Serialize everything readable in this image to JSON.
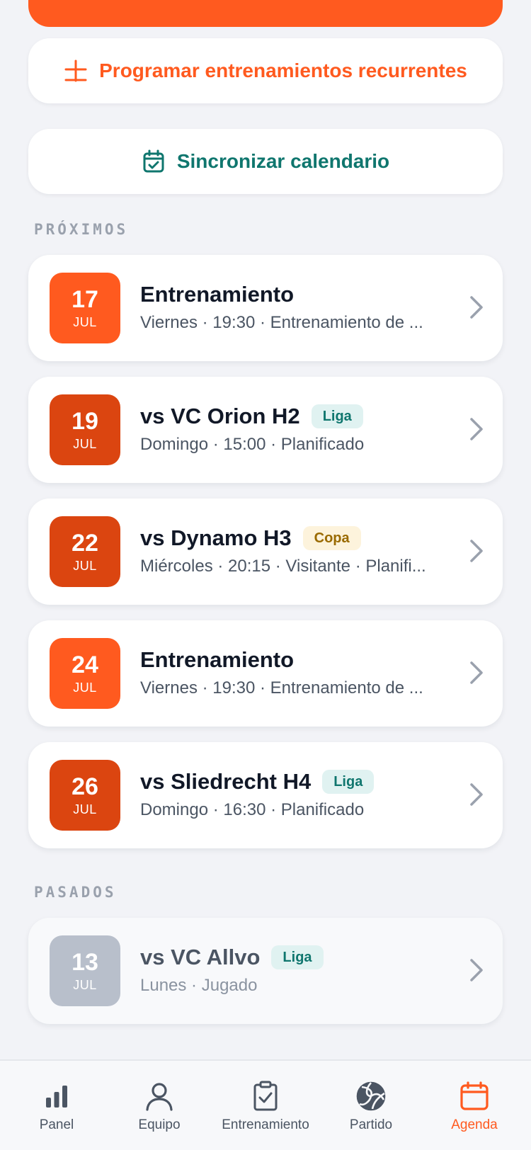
{
  "actions": {
    "recurring_label": "Programar entrenamientos recurrentes",
    "sync_label": "Sincronizar calendario"
  },
  "sections": {
    "upcoming": "PRÓXIMOS",
    "past": "PASADOS"
  },
  "upcoming_events": [
    {
      "day": "17",
      "month": "JUL",
      "title": "Entrenamiento",
      "badge": "",
      "subtitle": "Viernes · 19:30 · Entrenamiento de ...",
      "box_color": "#ff5a1f"
    },
    {
      "day": "19",
      "month": "JUL",
      "title": "vs VC Orion H2",
      "badge": "Liga",
      "subtitle": "Domingo · 15:00 · Planificado",
      "box_color": "#db4510"
    },
    {
      "day": "22",
      "month": "JUL",
      "title": "vs Dynamo H3",
      "badge": "Copa",
      "subtitle": "Miércoles · 20:15 · Visitante · Planifi...",
      "box_color": "#db4510"
    },
    {
      "day": "24",
      "month": "JUL",
      "title": "Entrenamiento",
      "badge": "",
      "subtitle": "Viernes · 19:30 · Entrenamiento de ...",
      "box_color": "#ff5a1f"
    },
    {
      "day": "26",
      "month": "JUL",
      "title": "vs Sliedrecht H4",
      "badge": "Liga",
      "subtitle": "Domingo · 16:30 · Planificado",
      "box_color": "#db4510"
    }
  ],
  "past_events": [
    {
      "day": "13",
      "month": "JUL",
      "title": "vs VC Allvo",
      "badge": "Liga",
      "subtitle": "Lunes · Jugado",
      "box_color": "#b8bfcb"
    }
  ],
  "badge_styles": {
    "Liga": {
      "bg": "#e0f2f1",
      "fg": "#0f766e"
    },
    "Copa": {
      "bg": "#fdf3dc",
      "fg": "#9a6a00"
    }
  },
  "tabs": [
    {
      "label": "Panel",
      "icon": "bar-chart-icon",
      "active": false
    },
    {
      "label": "Equipo",
      "icon": "user-icon",
      "active": false
    },
    {
      "label": "Entrenamiento",
      "icon": "clipboard-check-icon",
      "active": false
    },
    {
      "label": "Partido",
      "icon": "volleyball-icon",
      "active": false
    },
    {
      "label": "Agenda",
      "icon": "calendar-icon",
      "active": true
    }
  ],
  "colors": {
    "accent": "#ff5a1f",
    "teal": "#0f766e",
    "inactive_icon": "#4b5563"
  }
}
